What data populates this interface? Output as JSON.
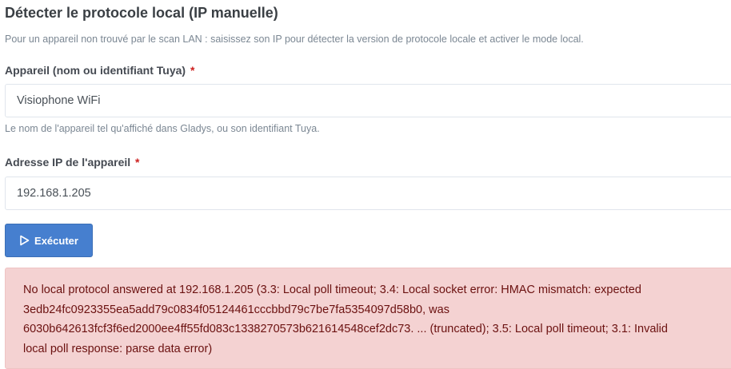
{
  "header": {
    "title": "Détecter le protocole local (IP manuelle)",
    "description": "Pour un appareil non trouvé par le scan LAN : saisissez son IP pour détecter la version de protocole locale et activer le mode local."
  },
  "form": {
    "device": {
      "label": "Appareil (nom ou identifiant Tuya)",
      "required_marker": "*",
      "value": "Visiophone WiFi",
      "help": "Le nom de l'appareil tel qu'affiché dans Gladys, ou son identifiant Tuya."
    },
    "ip": {
      "label": "Adresse IP de l'appareil",
      "required_marker": "*",
      "value": "192.168.1.205"
    },
    "submit": {
      "label": "Exécuter",
      "icon": "play-outline-icon"
    }
  },
  "alert": {
    "lines": [
      "No local protocol answered at 192.168.1.205 (3.3: Local poll timeout; 3.4: Local socket error: HMAC mismatch: expected",
      "3edb24fc0923355ea5add79c0834f05124461cccbbd79c7be7fa5354097d58b0, was",
      "6030b642613fcf3f6ed2000ee4ff55fd083c1338270573b621614548cef2dc73. ... (truncated); 3.5: Local poll timeout; 3.1: Invalid",
      "local poll response: parse data error)"
    ]
  },
  "colors": {
    "primary": "#467fcf",
    "required": "#cd201f",
    "alert_bg": "#f4d2d2",
    "alert_text": "#6b1110"
  }
}
